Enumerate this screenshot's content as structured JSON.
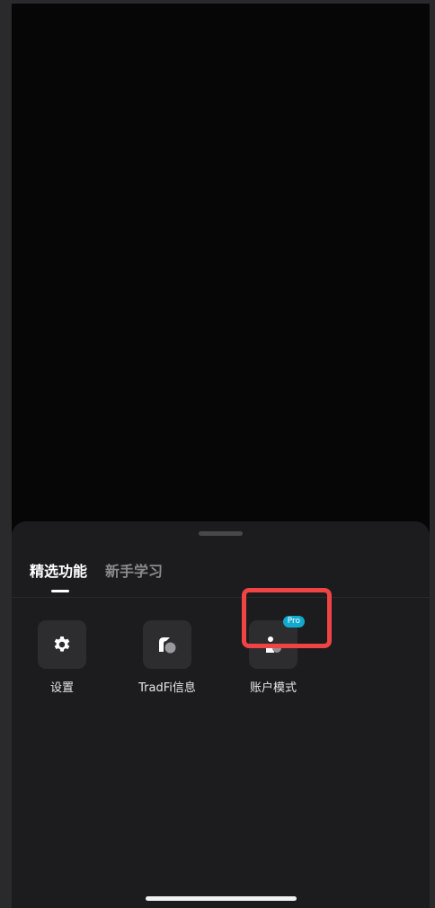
{
  "tabs": [
    {
      "label": "精选功能",
      "active": true
    },
    {
      "label": "新手学习",
      "active": false
    }
  ],
  "features": [
    {
      "label": "设置",
      "icon": "gear-icon"
    },
    {
      "label": "TradFi信息",
      "icon": "tradfi-icon"
    },
    {
      "label": "账户模式",
      "icon": "account-mode-icon",
      "badge": "Pro"
    }
  ],
  "colors": {
    "sheet_bg": "#1c1c1e",
    "tile_bg": "#2d2d30",
    "badge": "#12a9cf",
    "highlight": "#f04444"
  }
}
